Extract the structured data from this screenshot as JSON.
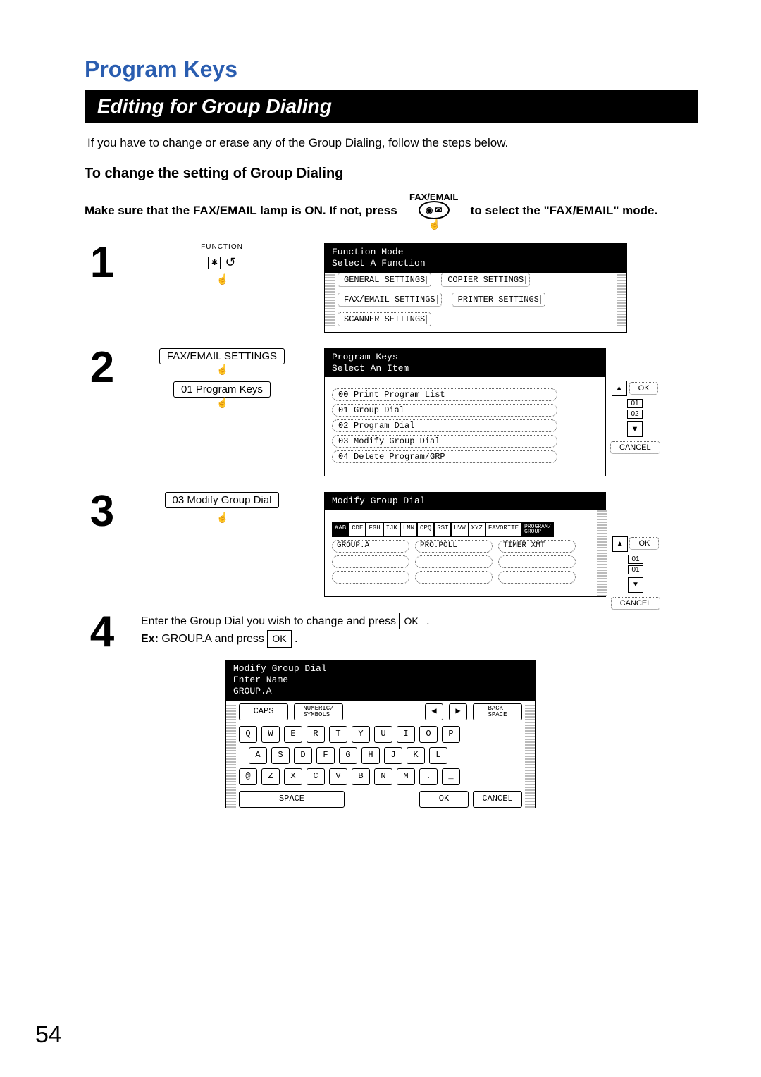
{
  "page_number": "54",
  "title": "Program Keys",
  "bar_title": "Editing for Group Dialing",
  "intro": "If you have to change or erase any of the Group Dialing, follow the steps below.",
  "subhead": "To change the setting of Group Dialing",
  "instruction": {
    "pre": "Make sure that the FAX/EMAIL lamp is ON.  If not, press",
    "btn_top_label": "FAX/EMAIL",
    "post": "to select the \"FAX/EMAIL\" mode."
  },
  "step1": {
    "num": "1",
    "fn_label": "FUNCTION",
    "screen_hdr_l1": "Function Mode",
    "screen_hdr_l2": "Select A Function",
    "buttons": [
      "GENERAL SETTINGS",
      "COPIER SETTINGS",
      "FAX/EMAIL SETTINGS",
      "PRINTER SETTINGS",
      "SCANNER SETTINGS"
    ]
  },
  "step2": {
    "num": "2",
    "left_btn1": "FAX/EMAIL SETTINGS",
    "left_btn2": "01 Program Keys",
    "screen_hdr_l1": "Program Keys",
    "screen_hdr_l2": "Select An Item",
    "items": [
      {
        "n": "00",
        "t": "Print Program List"
      },
      {
        "n": "01",
        "t": "Group Dial"
      },
      {
        "n": "02",
        "t": "Program Dial"
      },
      {
        "n": "03",
        "t": "Modify Group Dial"
      },
      {
        "n": "04",
        "t": "Delete Program/GRP"
      }
    ],
    "side": {
      "page1": "01",
      "page2": "02",
      "ok": "OK",
      "cancel": "CANCEL"
    }
  },
  "step3": {
    "num": "3",
    "left_btn": "03 Modify Group Dial",
    "screen_hdr": "Modify Group Dial",
    "tabs": [
      "#AB",
      "CDE",
      "FGH",
      "IJK",
      "LMN",
      "OPQ",
      "RST",
      "UVW",
      "XYZ",
      "FAVORITE",
      "PROGRAM/\nGROUP"
    ],
    "fields_row1": [
      "GROUP.A",
      "PRO.POLL",
      "TIMER XMT"
    ],
    "side": {
      "page1": "01",
      "page2": "01",
      "ok": "OK",
      "cancel": "CANCEL"
    }
  },
  "step4": {
    "num": "4",
    "text_l1_a": "Enter the Group Dial you wish to change and press ",
    "text_l1_b": ".",
    "text_l2_a": "Ex:",
    "text_l2_b": " GROUP.A and press ",
    "text_l2_c": ".",
    "ok_label": "OK",
    "screen_hdr_l1": "Modify Group Dial",
    "screen_hdr_l2": "Enter Name",
    "screen_hdr_l3": "GROUP.A",
    "top": {
      "caps": "CAPS",
      "numsym": "NUMERIC/\nSYMBOLS",
      "back": "BACK\nSPACE"
    },
    "rows": {
      "r1": [
        "Q",
        "W",
        "E",
        "R",
        "T",
        "Y",
        "U",
        "I",
        "O",
        "P"
      ],
      "r2": [
        "A",
        "S",
        "D",
        "F",
        "G",
        "H",
        "J",
        "K",
        "L"
      ],
      "r3": [
        "@",
        "Z",
        "X",
        "C",
        "V",
        "B",
        "N",
        "M",
        ".",
        "_"
      ]
    },
    "bottom": {
      "space": "SPACE",
      "ok": "OK",
      "cancel": "CANCEL"
    }
  }
}
